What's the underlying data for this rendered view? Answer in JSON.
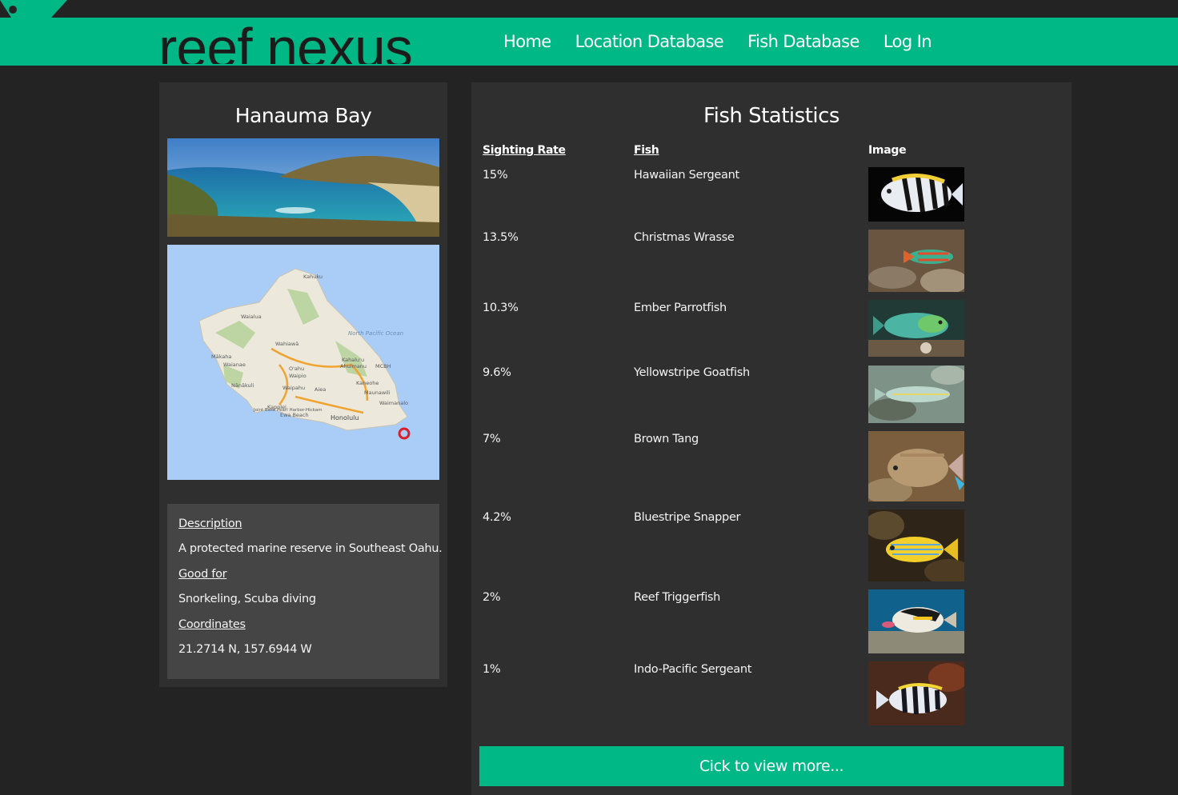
{
  "brand": {
    "name": "reef nexus",
    "accent": "#00b886"
  },
  "nav": {
    "items": [
      "Home",
      "Location Database",
      "Fish Database",
      "Log In"
    ]
  },
  "location": {
    "title": "Hanauma Bay",
    "description_label": "Description",
    "description": "A protected marine reserve in Southeast Oahu.",
    "good_for_label": "Good for",
    "good_for": "Snorkeling, Scuba diving",
    "coordinates_label": "Coordinates",
    "coordinates": "21.2714 N, 157.6944 W"
  },
  "map": {
    "ocean_label": "North Pacific Ocean",
    "places": [
      "Kahuku",
      "Waialua",
      "Wahiawā",
      "O'ahu",
      "Waipio",
      "Mākaha",
      "Waianae",
      "Nānākuli",
      "Waipahu",
      "Aiea",
      "Kahalu'u",
      "Ahuimanu",
      "MCBH",
      "Kaneohe",
      "Maunawili",
      "Waimanalo",
      "Joint Base Pearl Harbor-Hickam",
      "Kapolei",
      "Ewa Beach",
      "Honolulu"
    ]
  },
  "stats": {
    "title": "Fish Statistics",
    "headers": {
      "rate": "Sighting Rate",
      "fish": "Fish",
      "image": "Image"
    },
    "rows": [
      {
        "rate": "15%",
        "fish": "Hawaiian Sergeant",
        "image": "hawaiian-sergeant"
      },
      {
        "rate": "13.5%",
        "fish": "Christmas Wrasse",
        "image": "christmas-wrasse"
      },
      {
        "rate": "10.3%",
        "fish": "Ember Parrotfish",
        "image": "ember-parrotfish"
      },
      {
        "rate": "9.6%",
        "fish": "Yellowstripe Goatfish",
        "image": "yellowstripe-goatfish"
      },
      {
        "rate": "7%",
        "fish": "Brown Tang",
        "image": "brown-tang"
      },
      {
        "rate": "4.2%",
        "fish": "Bluestripe Snapper",
        "image": "bluestripe-snapper"
      },
      {
        "rate": "2%",
        "fish": "Reef Triggerfish",
        "image": "reef-triggerfish"
      },
      {
        "rate": "1%",
        "fish": "Indo-Pacific Sergeant",
        "image": "indo-pacific-sergeant"
      }
    ],
    "more_button": "Cick to view more..."
  }
}
